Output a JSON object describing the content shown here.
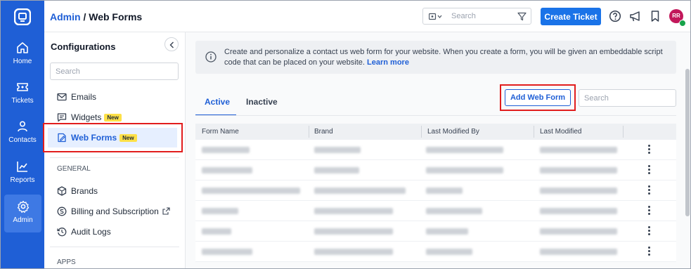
{
  "rail": {
    "items": [
      {
        "label": "Home",
        "icon": "home-icon"
      },
      {
        "label": "Tickets",
        "icon": "ticket-icon"
      },
      {
        "label": "Contacts",
        "icon": "contacts-icon"
      },
      {
        "label": "Reports",
        "icon": "reports-icon"
      },
      {
        "label": "Admin",
        "icon": "admin-gear-icon",
        "active": true
      }
    ]
  },
  "header": {
    "breadcrumb_link": "Admin",
    "breadcrumb_sep": " / ",
    "breadcrumb_current": "Web Forms",
    "search_placeholder": "Search",
    "create_ticket": "Create Ticket",
    "avatar_initials": "RR"
  },
  "config": {
    "title": "Configurations",
    "search_placeholder": "Search",
    "items_top": [
      {
        "label": "Emails",
        "icon": "mail-icon"
      },
      {
        "label": "Widgets",
        "icon": "widget-icon",
        "badge": "New"
      },
      {
        "label": "Web Forms",
        "icon": "webform-icon",
        "badge": "New",
        "active": true
      }
    ],
    "section_general": "GENERAL",
    "items_general": [
      {
        "label": "Brands",
        "icon": "cube-icon"
      },
      {
        "label": "Billing and Subscription",
        "icon": "billing-icon",
        "external": true
      },
      {
        "label": "Audit Logs",
        "icon": "history-icon"
      }
    ],
    "section_apps": "APPS"
  },
  "main": {
    "info_text": "Create and personalize a contact us web form for your website. When you create a form, you will be given an embeddable script code that can be placed on your website.",
    "info_link": "Learn more",
    "tabs": [
      {
        "label": "Active",
        "active": true
      },
      {
        "label": "Inactive",
        "active": false
      }
    ],
    "add_button": "Add Web Form",
    "search_placeholder": "Search",
    "table": {
      "columns": [
        "Form Name",
        "Brand",
        "Last Modified By",
        "Last Modified"
      ],
      "row_count": 6
    }
  },
  "colors": {
    "rail": "#1f5fd6",
    "accent": "#1a73e8",
    "highlight": "#e11d1d",
    "badge": "#fde047"
  }
}
